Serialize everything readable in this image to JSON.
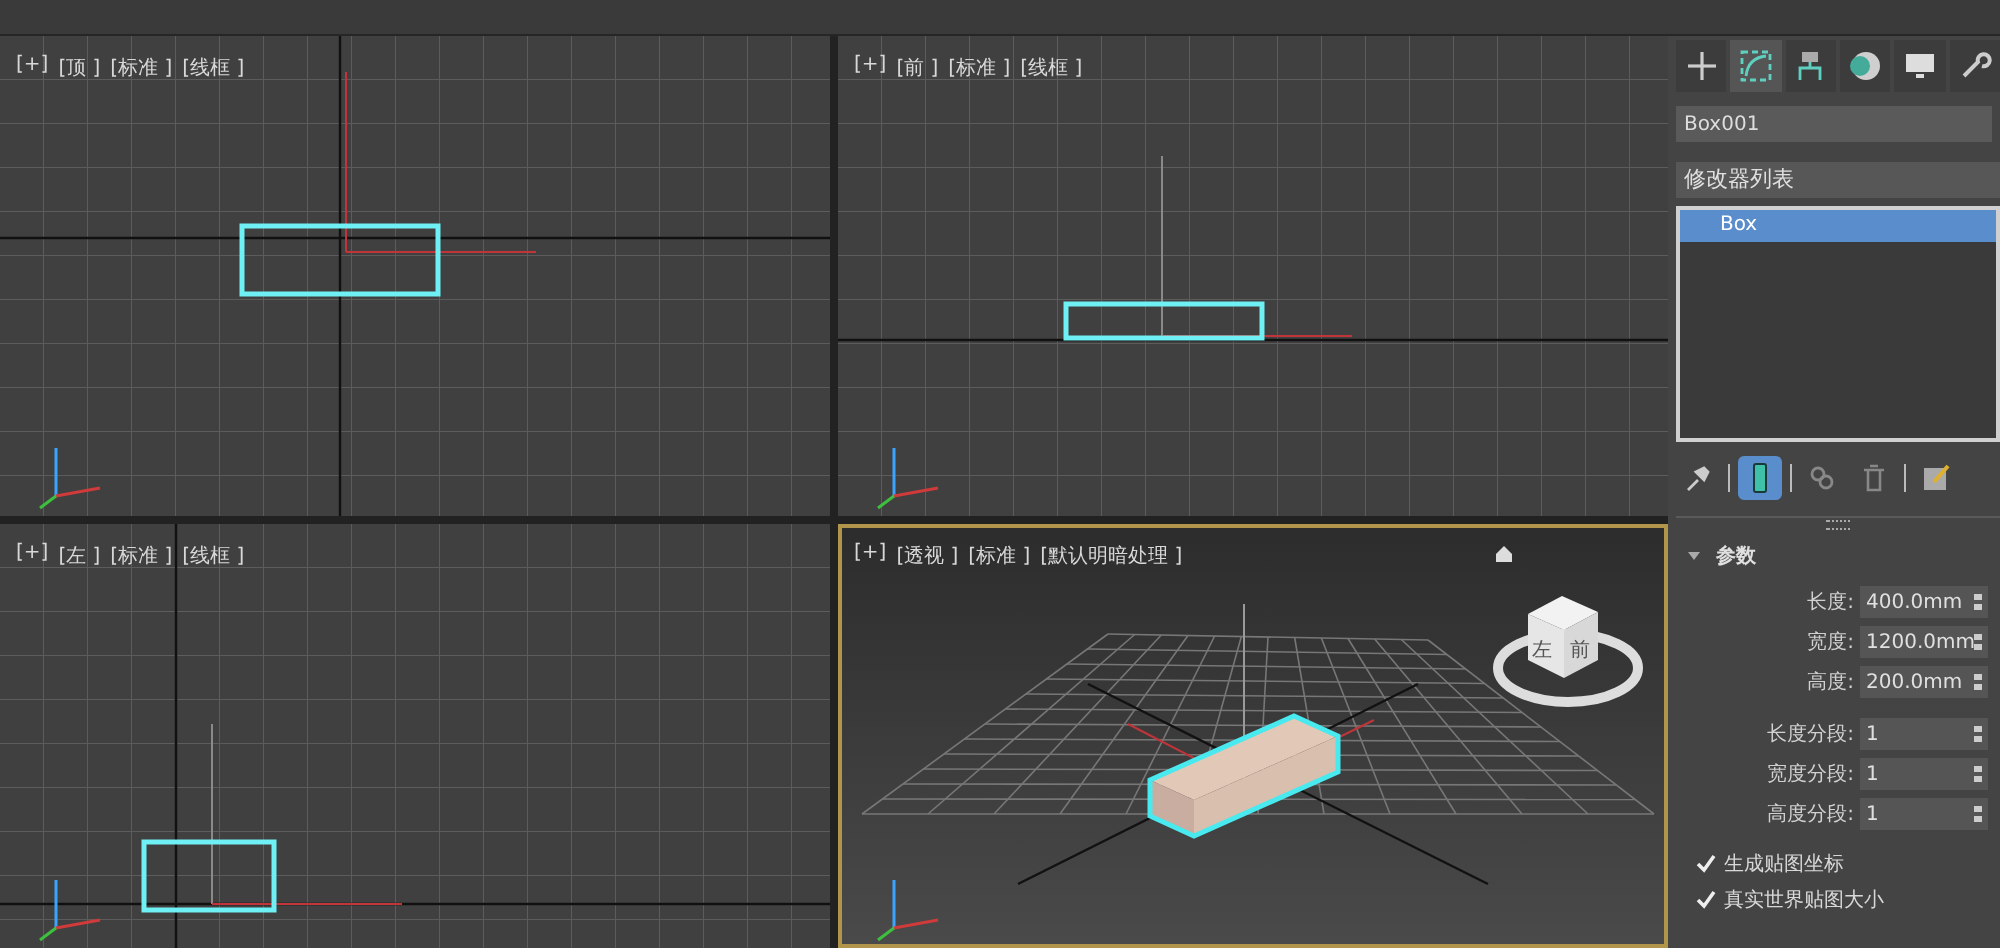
{
  "viewports": [
    {
      "kind": "top",
      "active": false,
      "labels": [
        "[+]",
        "[顶 ]",
        "[标准 ]",
        "[线框 ]"
      ]
    },
    {
      "kind": "front",
      "active": false,
      "labels": [
        "[+]",
        "[前 ]",
        "[标准 ]",
        "[线框 ]"
      ]
    },
    {
      "kind": "left",
      "active": false,
      "labels": [
        "[+]",
        "[左 ]",
        "[标准 ]",
        "[线框 ]"
      ]
    },
    {
      "kind": "perspective",
      "active": true,
      "labels": [
        "[+]",
        "[透视 ]",
        "[标准 ]",
        "[默认明暗处理 ]"
      ],
      "viewcube_faces": [
        "左",
        "前"
      ]
    }
  ],
  "command_tabs": [
    {
      "kind": "create",
      "selected": false
    },
    {
      "kind": "modify",
      "selected": true
    },
    {
      "kind": "hierarchy",
      "selected": false
    },
    {
      "kind": "motion",
      "selected": false
    },
    {
      "kind": "display",
      "selected": false
    },
    {
      "kind": "utilities",
      "selected": false
    }
  ],
  "object_name": "Box001",
  "modifier_list": {
    "label": "修改器列表"
  },
  "modifier_stack": [
    {
      "label": "Box",
      "selected": true
    }
  ],
  "stack_tools": [
    {
      "kind": "pin",
      "selected": false
    },
    {
      "kind": "show-end",
      "selected": true
    },
    {
      "kind": "unique",
      "selected": false
    },
    {
      "kind": "remove",
      "selected": false
    },
    {
      "kind": "configure",
      "selected": false
    }
  ],
  "rollout": {
    "title": "参数",
    "expanded": true,
    "fields": [
      {
        "label": "长度:",
        "value": "400.0mm"
      },
      {
        "label": "宽度:",
        "value": "1200.0mm"
      },
      {
        "label": "高度:",
        "value": "200.0mm"
      }
    ],
    "segments": [
      {
        "label": "长度分段:",
        "value": "1"
      },
      {
        "label": "宽度分段:",
        "value": "1"
      },
      {
        "label": "高度分段:",
        "value": "1"
      }
    ],
    "checkboxes": [
      {
        "label": "生成贴图坐标",
        "checked": true
      },
      {
        "label": "真实世界贴图大小",
        "checked": true
      }
    ]
  }
}
